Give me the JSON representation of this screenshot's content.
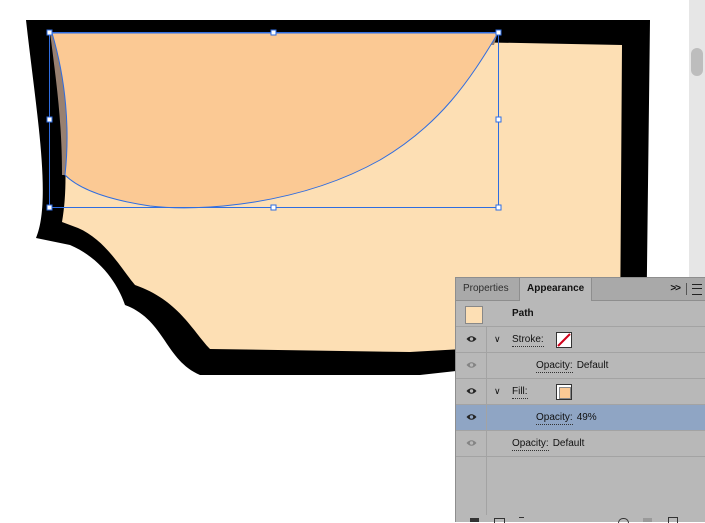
{
  "colors": {
    "outline": "#000000",
    "fill_light": "#fddfb4",
    "fill_dark": "#fbc994",
    "selection": "#2f6de0",
    "shadow": "#988070",
    "panel_bg": "#b8b8b8",
    "selected_row": "#8fa5c4"
  },
  "panel": {
    "tabs": [
      {
        "label": "Properties",
        "active": false
      },
      {
        "label": "Appearance",
        "active": true
      }
    ],
    "collapse_icon": ">>",
    "object_label": "Path",
    "stroke": {
      "label": "Stroke:",
      "swatch": "none"
    },
    "stroke_opacity": {
      "label": "Opacity:",
      "value": "Default"
    },
    "fill": {
      "label": "Fill:",
      "swatch": "#fbc994"
    },
    "fill_opacity": {
      "label": "Opacity:",
      "value": "49%",
      "selected": true
    },
    "object_opacity": {
      "label": "Opacity:",
      "value": "Default"
    }
  }
}
